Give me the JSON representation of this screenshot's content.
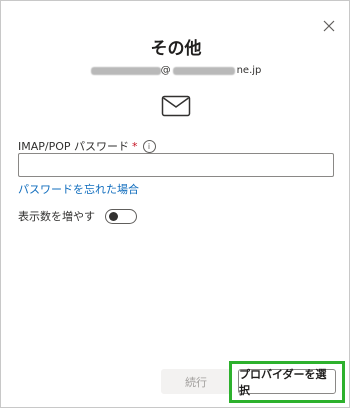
{
  "dialog": {
    "title": "その他",
    "email_suffix": "@",
    "email_domain": "ne.jp",
    "close_icon": "close-icon",
    "mail_icon": "mail-icon"
  },
  "password": {
    "label": "IMAP/POP パスワード",
    "required_mark": "*",
    "info_glyph": "i",
    "value": "",
    "forgot_link": "パスワードを忘れた場合"
  },
  "more_options": {
    "label": "表示数を増やす",
    "toggle_on": false
  },
  "footer": {
    "continue_label": "続行",
    "select_provider_label": "プロバイダーを選択",
    "highlight_color": "#2db12d"
  }
}
